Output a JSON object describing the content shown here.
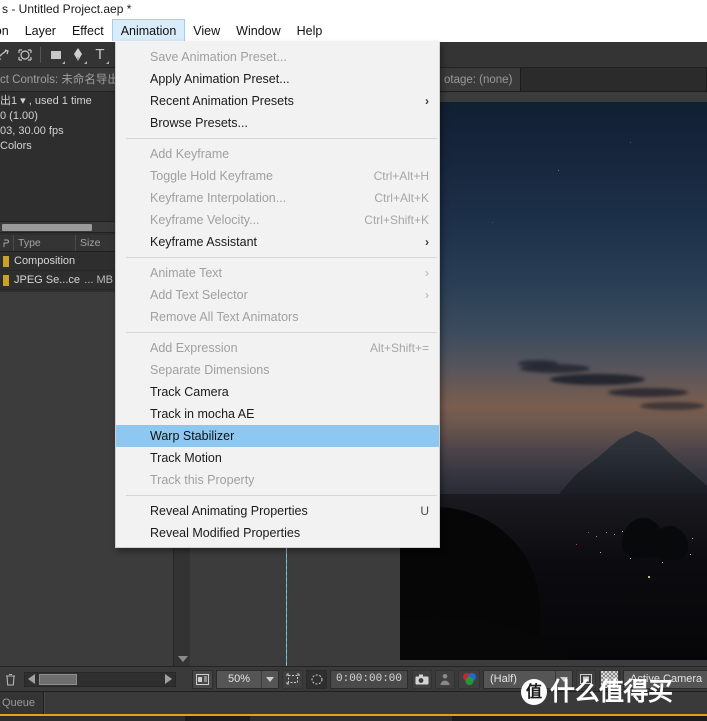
{
  "window": {
    "title": "s - Untitled Project.aep *"
  },
  "menubar": {
    "items": [
      {
        "label": "ion",
        "active": false
      },
      {
        "label": "Layer",
        "active": false
      },
      {
        "label": "Effect",
        "active": false
      },
      {
        "label": "Animation",
        "active": true
      },
      {
        "label": "View",
        "active": false
      },
      {
        "label": "Window",
        "active": false
      },
      {
        "label": "Help",
        "active": false
      }
    ]
  },
  "toolbar": {
    "icons": [
      "rotate-tool-icon",
      "camera-tool-icon",
      "pan-behind-tool-icon",
      "shape-tool-icon",
      "pen-tool-icon",
      "text-tool-icon"
    ]
  },
  "animation_menu": {
    "name": "Animation",
    "highlight_color": "#8ec7ef",
    "groups": [
      {
        "items": [
          {
            "label": "Save Animation Preset...",
            "accel": "",
            "disabled": true,
            "submenu": false,
            "selected": false
          },
          {
            "label": "Apply Animation Preset...",
            "accel": "",
            "disabled": false,
            "submenu": false,
            "selected": false
          },
          {
            "label": "Recent Animation Presets",
            "accel": "",
            "disabled": false,
            "submenu": true,
            "selected": false
          },
          {
            "label": "Browse Presets...",
            "accel": "",
            "disabled": false,
            "submenu": false,
            "selected": false
          }
        ]
      },
      {
        "items": [
          {
            "label": "Add Keyframe",
            "accel": "",
            "disabled": true,
            "submenu": false,
            "selected": false
          },
          {
            "label": "Toggle Hold Keyframe",
            "accel": "Ctrl+Alt+H",
            "disabled": true,
            "submenu": false,
            "selected": false
          },
          {
            "label": "Keyframe Interpolation...",
            "accel": "Ctrl+Alt+K",
            "disabled": true,
            "submenu": false,
            "selected": false
          },
          {
            "label": "Keyframe Velocity...",
            "accel": "Ctrl+Shift+K",
            "disabled": true,
            "submenu": false,
            "selected": false
          },
          {
            "label": "Keyframe Assistant",
            "accel": "",
            "disabled": false,
            "submenu": true,
            "selected": false
          }
        ]
      },
      {
        "items": [
          {
            "label": "Animate Text",
            "accel": "",
            "disabled": true,
            "submenu": true,
            "selected": false
          },
          {
            "label": "Add Text Selector",
            "accel": "",
            "disabled": true,
            "submenu": true,
            "selected": false
          },
          {
            "label": "Remove All Text Animators",
            "accel": "",
            "disabled": true,
            "submenu": false,
            "selected": false
          }
        ]
      },
      {
        "items": [
          {
            "label": "Add Expression",
            "accel": "Alt+Shift+=",
            "disabled": true,
            "submenu": false,
            "selected": false
          },
          {
            "label": "Separate Dimensions",
            "accel": "",
            "disabled": true,
            "submenu": false,
            "selected": false
          },
          {
            "label": "Track Camera",
            "accel": "",
            "disabled": false,
            "submenu": false,
            "selected": false
          },
          {
            "label": "Track in mocha AE",
            "accel": "",
            "disabled": false,
            "submenu": false,
            "selected": false
          },
          {
            "label": "Warp Stabilizer",
            "accel": "",
            "disabled": false,
            "submenu": false,
            "selected": true
          },
          {
            "label": "Track Motion",
            "accel": "",
            "disabled": false,
            "submenu": false,
            "selected": false
          },
          {
            "label": "Track this Property",
            "accel": "",
            "disabled": true,
            "submenu": false,
            "selected": false
          }
        ]
      },
      {
        "items": [
          {
            "label": "Reveal Animating Properties",
            "accel": "U",
            "disabled": false,
            "submenu": false,
            "selected": false
          },
          {
            "label": "Reveal Modified Properties",
            "accel": "",
            "disabled": false,
            "submenu": false,
            "selected": false
          }
        ]
      }
    ]
  },
  "effect_controls": {
    "tab_label": "ct Controls: 未命名导出"
  },
  "project_info": {
    "lines": [
      "出1 ▾ , used 1 time",
      "0 (1.00)",
      "03, 30.00 fps",
      " Colors"
    ]
  },
  "project_list": {
    "columns": [
      "Type",
      "Size"
    ],
    "sort_icon": "sort-icon",
    "rows": [
      {
        "type": "Composition",
        "size": ""
      },
      {
        "type": "JPEG Se...ce",
        "size": "... MB"
      }
    ]
  },
  "footage_tab": {
    "label": "otage: (none)"
  },
  "viewer_bar": {
    "grid_button": "grid-guides-icon",
    "zoom": "50%",
    "region_of_interest": "region-of-interest-icon",
    "mask_icon": "mask-icon",
    "timecode": "0:00:00:00",
    "snapshot_icon": "camera-icon",
    "show_snapshot_icon": "person-icon",
    "channel_icon": "channels-icon",
    "resolution": "(Half)",
    "transparency_icon": "transparency-grid-icon",
    "view_mode": "Active Camera"
  },
  "render_queue": {
    "tab_label": "Queue"
  },
  "timeline_bottom": {
    "trash_icon": "trash-icon",
    "scroll_left_icon": "scroll-left-arrow",
    "scroll_right_icon": "scroll-right-arrow"
  },
  "watermark": {
    "logo": "值",
    "text": "什么值得买"
  },
  "colors": {
    "menu_bg": "#f2f2f2",
    "menu_highlight": "#8ec7ef",
    "panel_bg": "#2e2e2e",
    "accent_orange": "#e0a020",
    "guide_cyan": "#7bd2e0"
  }
}
